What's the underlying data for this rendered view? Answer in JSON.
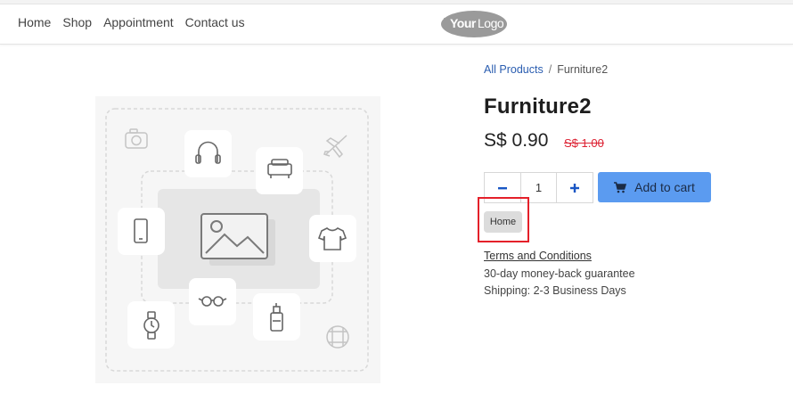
{
  "header": {
    "nav": [
      {
        "label": "Home"
      },
      {
        "label": "Shop"
      },
      {
        "label": "Appointment"
      },
      {
        "label": "Contact us"
      }
    ],
    "logo_text": "YourLogo"
  },
  "breadcrumb": {
    "parent": "All Products",
    "separator": "/",
    "current": "Furniture2"
  },
  "product": {
    "title": "Furniture2",
    "price": "S$ 0.90",
    "old_price": "S$ 1.00",
    "quantity": "1",
    "add_to_cart": "Add to cart",
    "tag": "Home",
    "terms": "Terms and Conditions",
    "guarantee": "30-day money-back guarantee",
    "shipping": "Shipping: 2-3 Business Days"
  },
  "colors": {
    "accent": "#5b9bf0",
    "link": "#2a5db0",
    "old_price": "#dd2233",
    "highlight": "#e4202a"
  },
  "icons": [
    "minus-icon",
    "plus-icon",
    "cart-icon",
    "camera-icon",
    "headphones-icon",
    "sofa-icon",
    "airplane-icon",
    "phone-icon",
    "image-placeholder-icon",
    "tshirt-icon",
    "glasses-icon",
    "watch-icon",
    "perfume-icon",
    "ball-icon"
  ]
}
